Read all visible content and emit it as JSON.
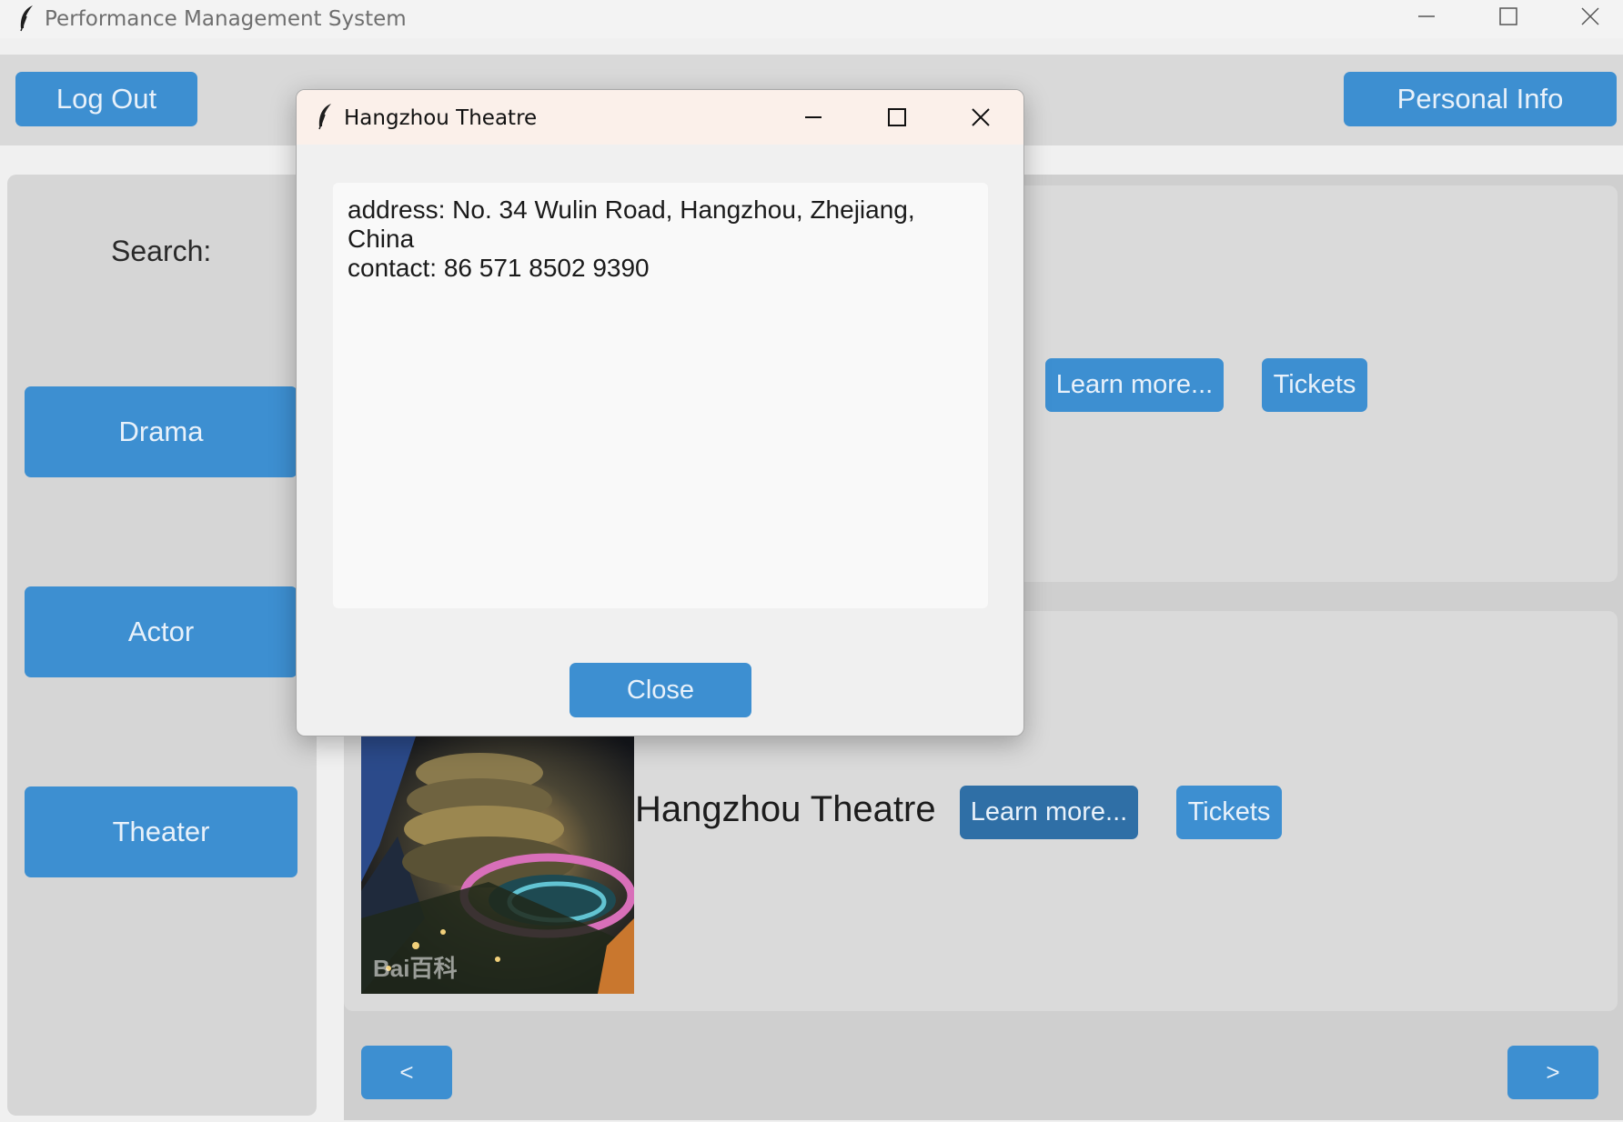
{
  "window": {
    "title": "Performance Management System",
    "icon": "feather-icon",
    "controls": [
      "minimize-icon",
      "maximize-icon",
      "close-icon"
    ]
  },
  "topbar": {
    "logout_label": "Log Out",
    "personal_info_label": "Personal Info"
  },
  "sidebar": {
    "search_label": "Search:",
    "items": [
      {
        "label": "Drama"
      },
      {
        "label": "Actor"
      },
      {
        "label": "Theater"
      }
    ]
  },
  "main": {
    "cards": [
      {
        "title": "",
        "learn_more_label": "Learn more...",
        "tickets_label": "Tickets"
      },
      {
        "title": "Hangzhou Theatre",
        "learn_more_label": "Learn more...",
        "tickets_label": "Tickets",
        "image_watermark": "Bai百科"
      }
    ],
    "pager": {
      "prev_label": "<",
      "next_label": ">"
    }
  },
  "dialog": {
    "title": "Hangzhou Theatre",
    "text": "address: No. 34 Wulin Road, Hangzhou, Zhejiang,\nChina\ncontact: 86 571 8502 9390",
    "close_label": "Close"
  },
  "colors": {
    "button": "#3d8fd1",
    "button_active": "#2f6fa6",
    "panel": "#dadada",
    "dialog_titlebar": "#fbf0ea"
  }
}
